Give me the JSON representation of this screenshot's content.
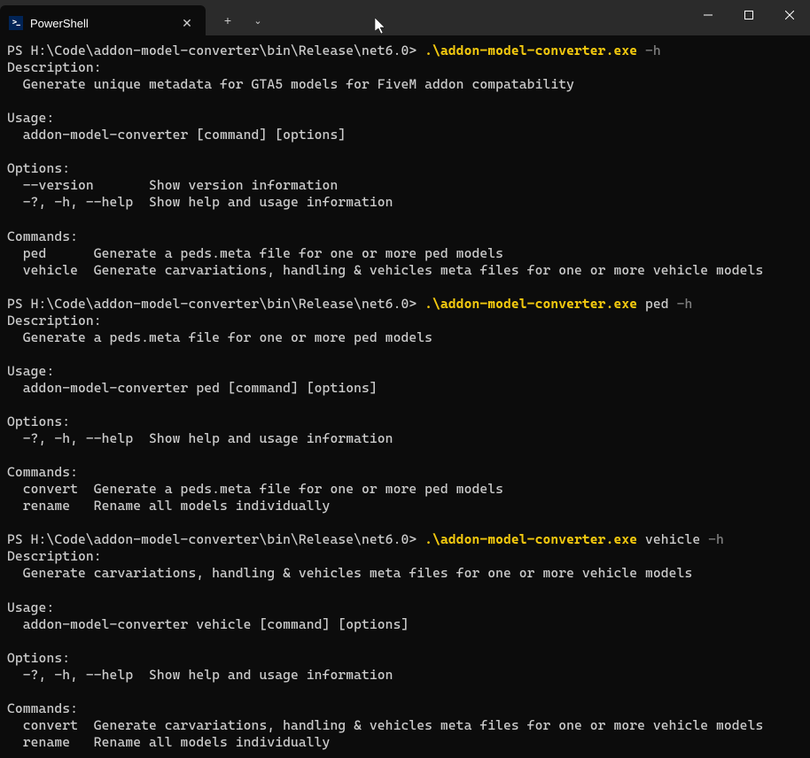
{
  "titlebar": {
    "tab_title": "PowerShell"
  },
  "terminal": {
    "prompt": "PS H:\\Code\\addon-model-converter\\bin\\Release\\net6.0>",
    "exe": ".\\addon-model-converter.exe",
    "cmd1": {
      "args": "-h",
      "output": "Description:\n  Generate unique metadata for GTA5 models for FiveM addon compatability\n\nUsage:\n  addon-model-converter [command] [options]\n\nOptions:\n  --version       Show version information\n  -?, -h, --help  Show help and usage information\n\nCommands:\n  ped      Generate a peds.meta file for one or more ped models\n  vehicle  Generate carvariations, handling & vehicles meta files for one or more vehicle models\n"
    },
    "cmd2": {
      "subcmd": "ped",
      "args": "-h",
      "output": "Description:\n  Generate a peds.meta file for one or more ped models\n\nUsage:\n  addon-model-converter ped [command] [options]\n\nOptions:\n  -?, -h, --help  Show help and usage information\n\nCommands:\n  convert  Generate a peds.meta file for one or more ped models\n  rename   Rename all models individually\n"
    },
    "cmd3": {
      "subcmd": "vehicle",
      "args": "-h",
      "output": "Description:\n  Generate carvariations, handling & vehicles meta files for one or more vehicle models\n\nUsage:\n  addon-model-converter vehicle [command] [options]\n\nOptions:\n  -?, -h, --help  Show help and usage information\n\nCommands:\n  convert  Generate carvariations, handling & vehicles meta files for one or more vehicle models\n  rename   Rename all models individually"
    }
  }
}
